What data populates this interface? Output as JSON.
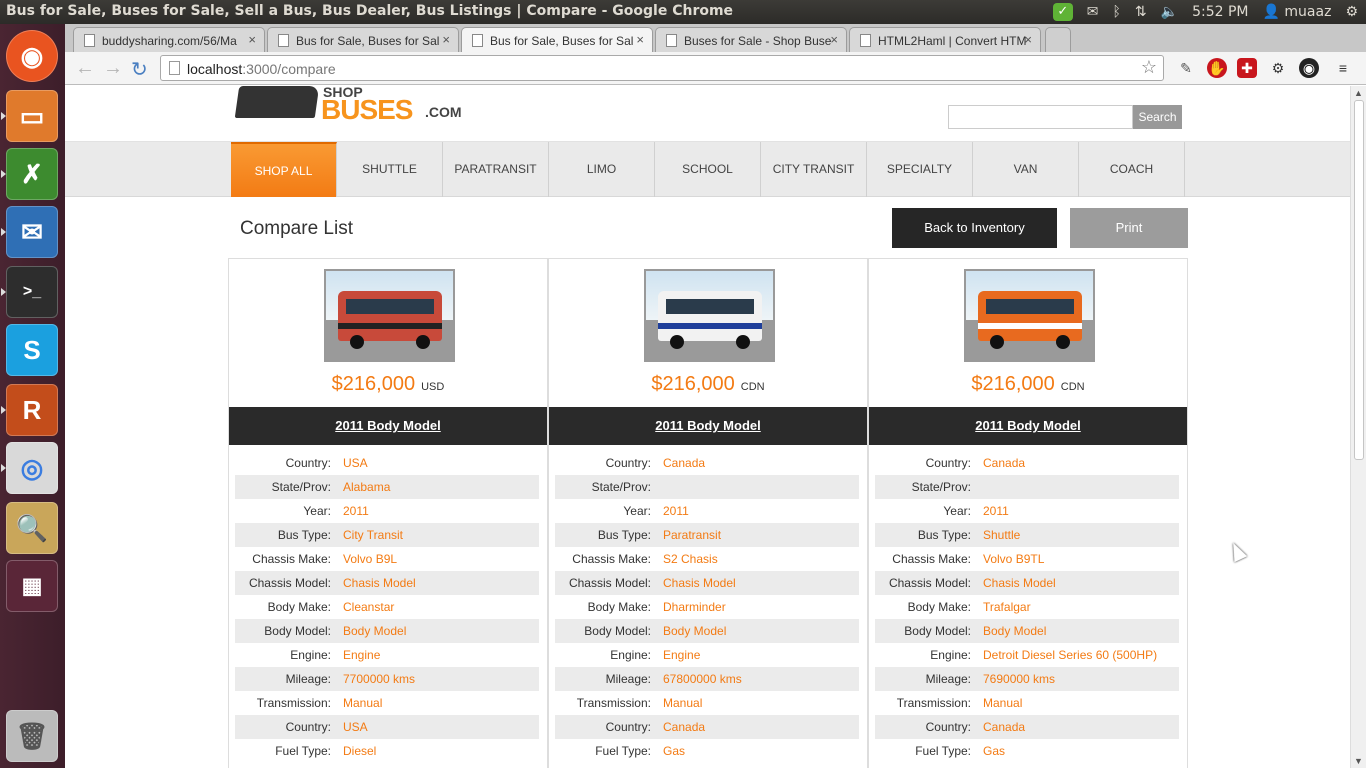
{
  "panel": {
    "window_title": "Bus for Sale, Buses for Sale, Sell a Bus, Bus Dealer, Bus Listings | Compare - Google Chrome",
    "time": "5:52 PM",
    "user": "muaaz"
  },
  "tabs": [
    {
      "label": "buddysharing.com/56/Ma"
    },
    {
      "label": "Bus for Sale, Buses for Sal"
    },
    {
      "label": "Bus for Sale, Buses for Sal"
    },
    {
      "label": "Buses for Sale - Shop Buse"
    },
    {
      "label": "HTML2Haml | Convert HTM"
    }
  ],
  "address": {
    "host": "localhost",
    "path": ":3000/compare"
  },
  "site": {
    "logo_shop": "SHOP",
    "logo_buses": "BUSES",
    ".com": ".com",
    "logo_com": ".COM",
    "search_button": "Search",
    "nav": [
      "SHOP ALL",
      "SHUTTLE",
      "PARATRANSIT",
      "LIMO",
      "SCHOOL",
      "CITY TRANSIT",
      "SPECIALTY",
      "VAN",
      "COACH"
    ]
  },
  "compare": {
    "title": "Compare List",
    "back_button": "Back to Inventory",
    "print_button": "Print",
    "labels": [
      "Country:",
      "State/Prov:",
      "Year:",
      "Bus Type:",
      "Chassis Make:",
      "Chassis Model:",
      "Body Make:",
      "Body Model:",
      "Engine:",
      "Mileage:",
      "Transmission:",
      "Country:",
      "Fuel Type:"
    ],
    "items": [
      {
        "price": "$216,000",
        "currency": "USD",
        "model": "2011 Body Model",
        "body_color": "#c84a3a",
        "stripe_color": "#222",
        "values": [
          "USA",
          "Alabama",
          "2011",
          "City Transit",
          "Volvo B9L",
          "Chasis Model",
          "Cleanstar",
          "Body Model",
          "Engine",
          "7700000 kms",
          "Manual",
          "USA",
          "Diesel"
        ]
      },
      {
        "price": "$216,000",
        "currency": "CDN",
        "model": "2011 Body Model",
        "body_color": "#f2f2f2",
        "stripe_color": "#1f3f9a",
        "values": [
          "Canada",
          "",
          "2011",
          "Paratransit",
          "S2 Chasis",
          "Chasis Model",
          "Dharminder",
          "Body Model",
          "Engine",
          "67800000 kms",
          "Manual",
          "Canada",
          "Gas"
        ]
      },
      {
        "price": "$216,000",
        "currency": "CDN",
        "model": "2011 Body Model",
        "body_color": "#e86a1f",
        "stripe_color": "#fff",
        "values": [
          "Canada",
          "",
          "2011",
          "Shuttle",
          "Volvo B9TL",
          "Chasis Model",
          "Trafalgar",
          "Body Model",
          "Detroit Diesel Series 60 (500HP)",
          "7690000 kms",
          "Manual",
          "Canada",
          "Gas"
        ]
      }
    ]
  }
}
